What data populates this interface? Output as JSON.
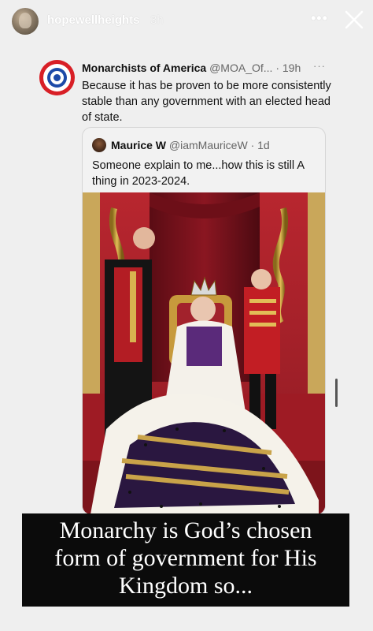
{
  "story": {
    "username": "hopewellheights",
    "time": "3h",
    "more_label": "•••"
  },
  "tweet": {
    "name": "Monarchists of America",
    "handle_time": "@MOA_Of... · 19h",
    "more_label": "···",
    "text": "Because it has be proven to be more consistently stable than any government with an elected head of state."
  },
  "quoted_tweet": {
    "name": "Maurice W",
    "handle_time": "@iamMauriceW · 1d",
    "text": "Someone explain to me...how this is still A thing in 2023-2024."
  },
  "caption": {
    "line1": "Monarchy is God’s chosen",
    "line2": "form of government for His",
    "line3": "Kingdom so..."
  },
  "colors": {
    "background": "#efefef",
    "caption_bg": "#0b0b0b",
    "roundel_red": "#d81f26",
    "roundel_blue": "#1d4aa8"
  }
}
